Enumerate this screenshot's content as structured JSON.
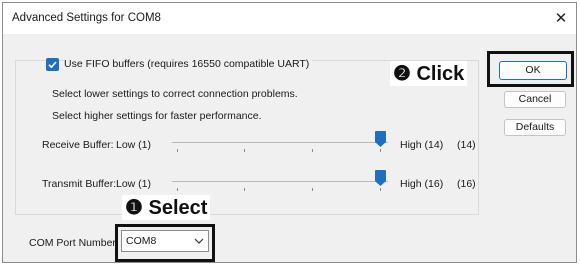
{
  "window": {
    "title": "Advanced Settings for COM8",
    "close_glyph": "✕"
  },
  "fifo": {
    "checked": true,
    "label": "Use FIFO buffers (requires 16550 compatible UART)",
    "hint_lower": "Select lower settings to correct connection problems.",
    "hint_higher": "Select higher settings for faster performance."
  },
  "receive": {
    "label": "Receive Buffer:",
    "low": "Low (1)",
    "high": "High (14)",
    "value": "(14)",
    "level": 1.0
  },
  "transmit": {
    "label": "Transmit Buffer:",
    "low": "Low (1)",
    "high": "High (16)",
    "value": "(16)",
    "level": 1.0
  },
  "com_port": {
    "label": "COM Port Number:",
    "selected": "COM8"
  },
  "buttons": {
    "ok": "OK",
    "cancel": "Cancel",
    "defaults": "Defaults"
  },
  "annotations": {
    "click": "❷ Click",
    "select": "❶ Select"
  },
  "icons": {
    "checkbox": "checkmark-icon",
    "dropdown": "chevron-down-icon",
    "thumb": "slider-thumb"
  }
}
